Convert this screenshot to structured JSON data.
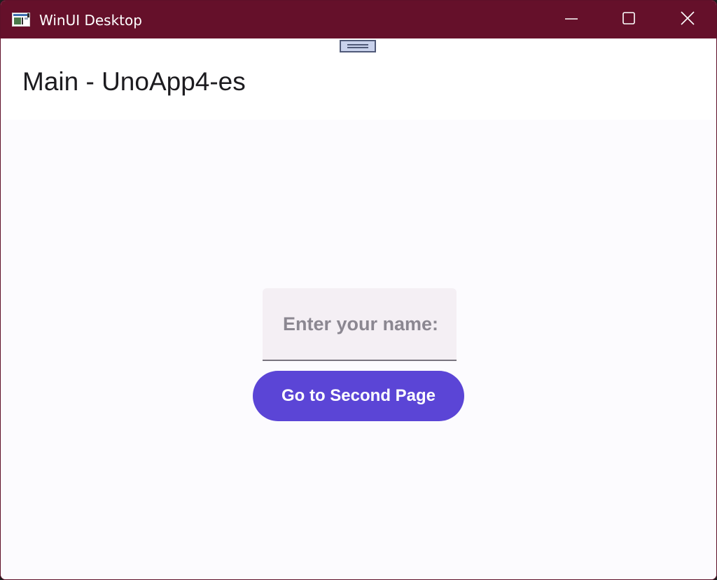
{
  "window": {
    "title": "WinUI Desktop",
    "icon": "app-window-icon",
    "controls": {
      "minimize_icon": "minimize-icon",
      "maximize_icon": "maximize-icon",
      "close_icon": "close-icon"
    }
  },
  "header": {
    "title": "Main - UnoApp4-es",
    "grip_icon": "drag-grip-icon"
  },
  "form": {
    "name_placeholder": "Enter your name:",
    "name_value": ""
  },
  "actions": {
    "second_page_label": "Go to Second Page"
  },
  "colors": {
    "titlebar": "#65102a",
    "primary": "#5b45d6",
    "field_background": "#f4eff4",
    "page_background": "#fcfbfe"
  }
}
